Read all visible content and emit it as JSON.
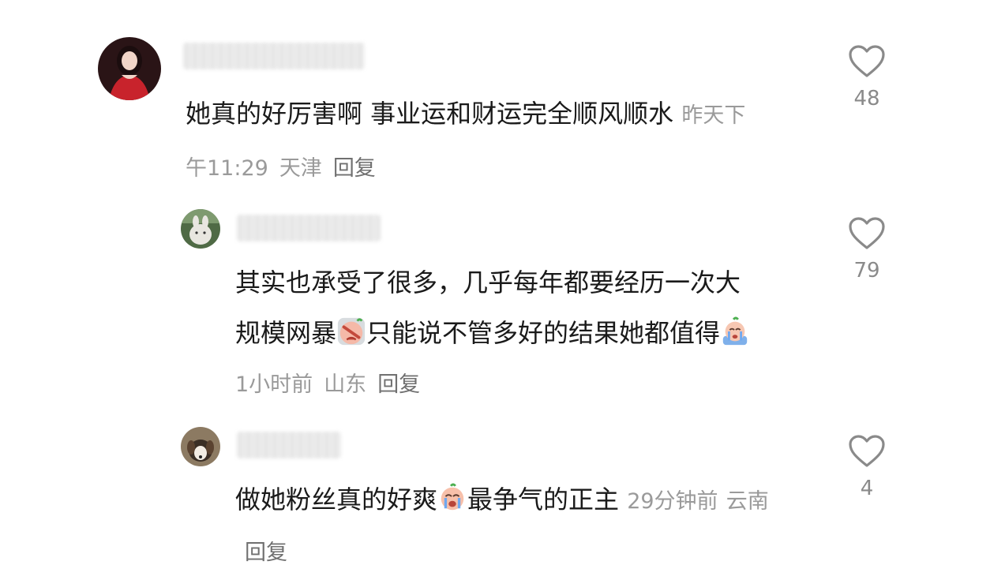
{
  "comments": [
    {
      "text": "她真的好厉害啊 事业运和财运完全顺风顺水",
      "time_inline": "昨天下",
      "time_rest": "午11:29",
      "location": "天津",
      "reply_label": "回复",
      "likes": "48"
    },
    {
      "text_line1": "其实也承受了很多，几乎每年都要经历一次大",
      "text_line2a": "规模网暴",
      "text_line2b": "只能说不管多好的结果她都值得",
      "time": "1小时前",
      "location": "山东",
      "reply_label": "回复",
      "likes": "79",
      "emojis": [
        "facepalm-emoji",
        "crying-emoji"
      ]
    },
    {
      "text_a": "做她粉丝真的好爽",
      "text_b": "最争气的正主",
      "time": "29分钟前",
      "location": "云南",
      "reply_label": "回复",
      "likes": "4",
      "emojis": [
        "crying-emoji"
      ]
    }
  ],
  "colors": {
    "text": "#1a1a1a",
    "meta": "#9a9a9a",
    "reply": "#707070",
    "icon": "#8a8a8a"
  }
}
